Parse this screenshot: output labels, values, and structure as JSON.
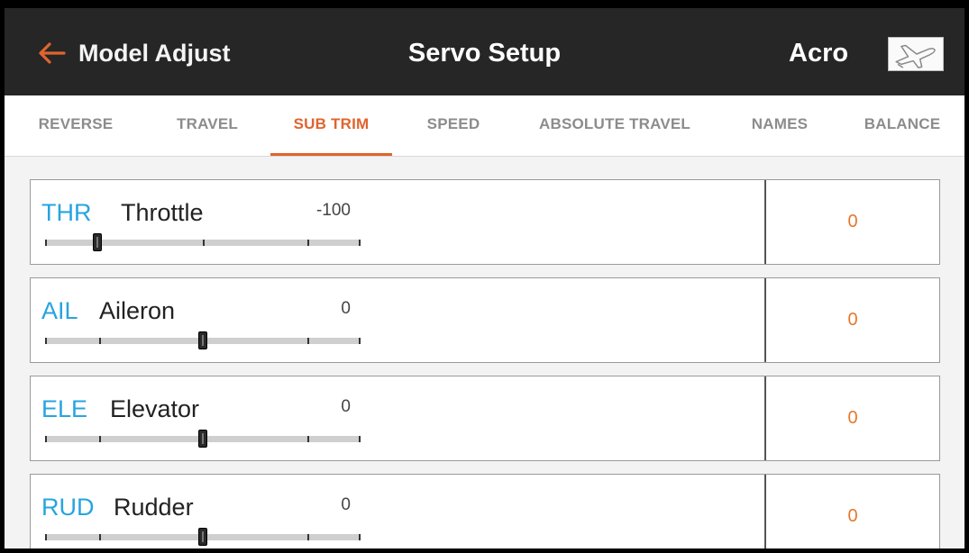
{
  "header": {
    "back_label": "Model Adjust",
    "title": "Servo Setup",
    "model_name": "Acro",
    "model_icon": "airplane-icon"
  },
  "tabs": [
    {
      "label": "REVERSE",
      "active": false
    },
    {
      "label": "TRAVEL",
      "active": false
    },
    {
      "label": "SUB TRIM",
      "active": true
    },
    {
      "label": "SPEED",
      "active": false
    },
    {
      "label": "ABSOLUTE TRAVEL",
      "active": false
    },
    {
      "label": "NAMES",
      "active": false
    },
    {
      "label": "BALANCE",
      "active": false
    }
  ],
  "channels": [
    {
      "code": "THR",
      "name": "Throttle",
      "value": "-100",
      "position": -100,
      "sub_trim": "0"
    },
    {
      "code": "AIL",
      "name": "Aileron",
      "value": "0",
      "position": 0,
      "sub_trim": "0"
    },
    {
      "code": "ELE",
      "name": "Elevator",
      "value": "0",
      "position": 0,
      "sub_trim": "0"
    },
    {
      "code": "RUD",
      "name": "Rudder",
      "value": "0",
      "position": 0,
      "sub_trim": "0"
    }
  ],
  "colors": {
    "accent": "#e0642e",
    "channel_code": "#27a4e0",
    "trim_value": "#e8772b",
    "header_bg": "#262626"
  }
}
